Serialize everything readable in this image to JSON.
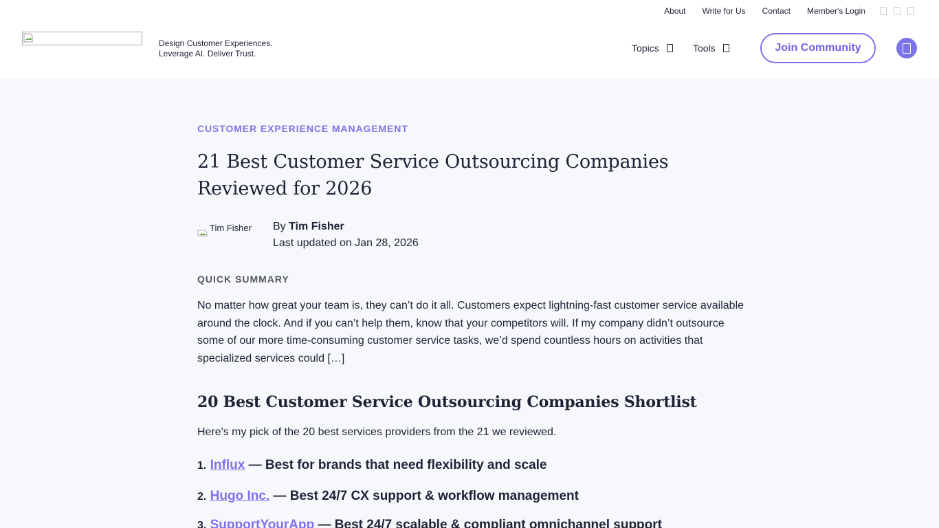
{
  "topbar": {
    "links": [
      "About",
      "Write for Us",
      "Contact",
      "Member's Login"
    ]
  },
  "header": {
    "tagline_line1": "Design Customer Experiences.",
    "tagline_line2": "Leverage AI. Deliver Trust.",
    "nav": {
      "topics": "Topics",
      "tools": "Tools"
    },
    "join_label": "Join Community"
  },
  "article": {
    "category": "CUSTOMER EXPERIENCE MANAGEMENT",
    "title": "21 Best Customer Service Outsourcing Companies Reviewed for 2026",
    "author_img_alt": "Tim Fisher",
    "by_label": "By",
    "author_name": "Tim Fisher",
    "updated": "Last updated on Jan 28, 2026",
    "summary_label": "QUICK SUMMARY",
    "summary": "No matter how great your team is, they can’t do it all. Customers expect lightning-fast customer service available around the clock. And if you can’t help them, know that your competitors will. If my company didn’t outsource some of our more time-consuming customer service tasks, we’d spend countless hours on activities that specialized services could […]",
    "shortlist_heading": "20 Best Customer Service Outsourcing Companies Shortlist",
    "shortlist_intro": "Here's my pick of the 20 best services providers from the 21 we reviewed.",
    "list": [
      {
        "num": "1.",
        "name": "Influx",
        "desc": " — Best for brands that need flexibility and scale"
      },
      {
        "num": "2.",
        "name": "Hugo Inc.",
        "desc": " — Best 24/7 CX support & workflow management"
      },
      {
        "num": "3.",
        "name": "SupportYourApp",
        "desc": " — Best 24/7 scalable & compliant omnichannel support"
      }
    ]
  },
  "colors": {
    "accent": "#7c74e8",
    "text": "#1e2235",
    "background": "#f6f8fb"
  }
}
